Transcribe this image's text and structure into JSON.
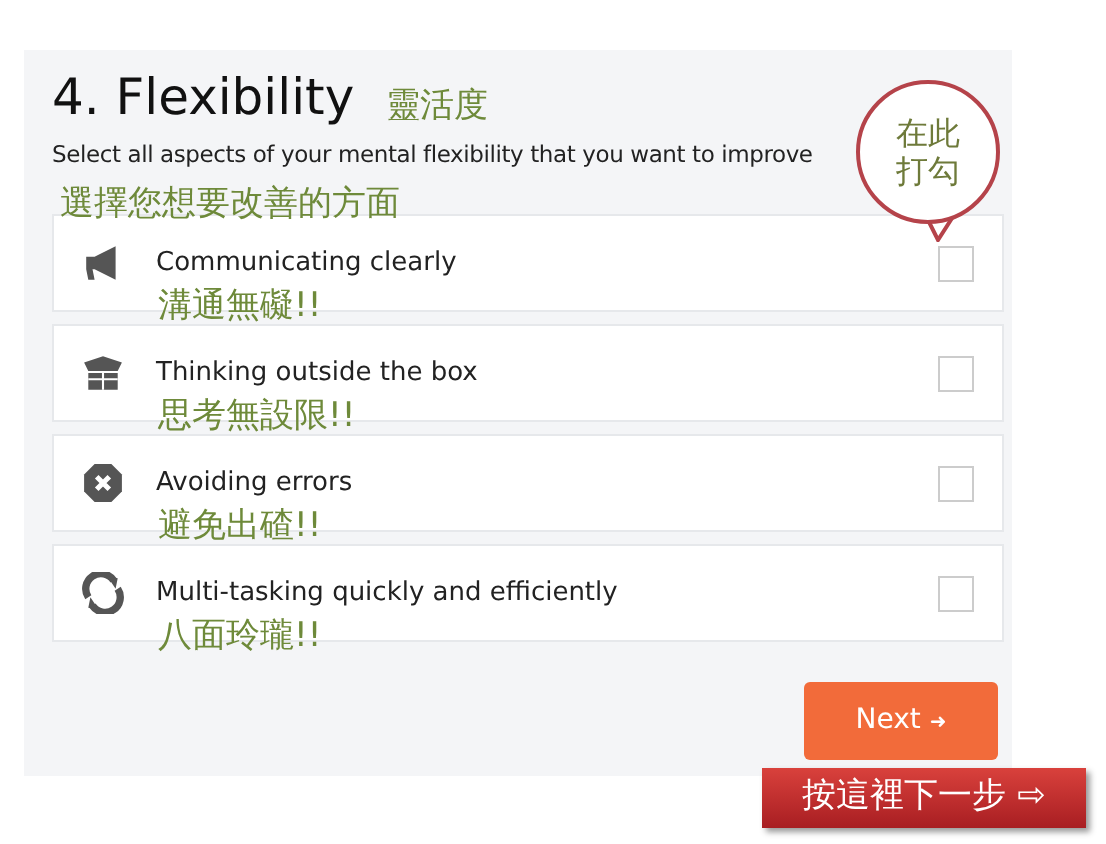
{
  "title": "4. Flexibility",
  "title_note": "靈活度",
  "subtitle": "Select all aspects of your mental flexibility that you want to improve",
  "subtitle_note": "選擇您想要改善的方面",
  "callout": [
    "在此",
    "打勾"
  ],
  "items": [
    {
      "label": "Communicating clearly",
      "note": "溝通無礙!!",
      "checked": false
    },
    {
      "label": "Thinking outside the box",
      "note": "思考無設限!!",
      "checked": false
    },
    {
      "label": "Avoiding errors",
      "note": "避免出碴!!",
      "checked": false
    },
    {
      "label": "Multi-tasking quickly and efficiently",
      "note": "八面玲瓏!!",
      "checked": false
    }
  ],
  "next_button": {
    "label": "Next",
    "arrow": "➜"
  },
  "banner": "按這裡下一步 ⇨"
}
